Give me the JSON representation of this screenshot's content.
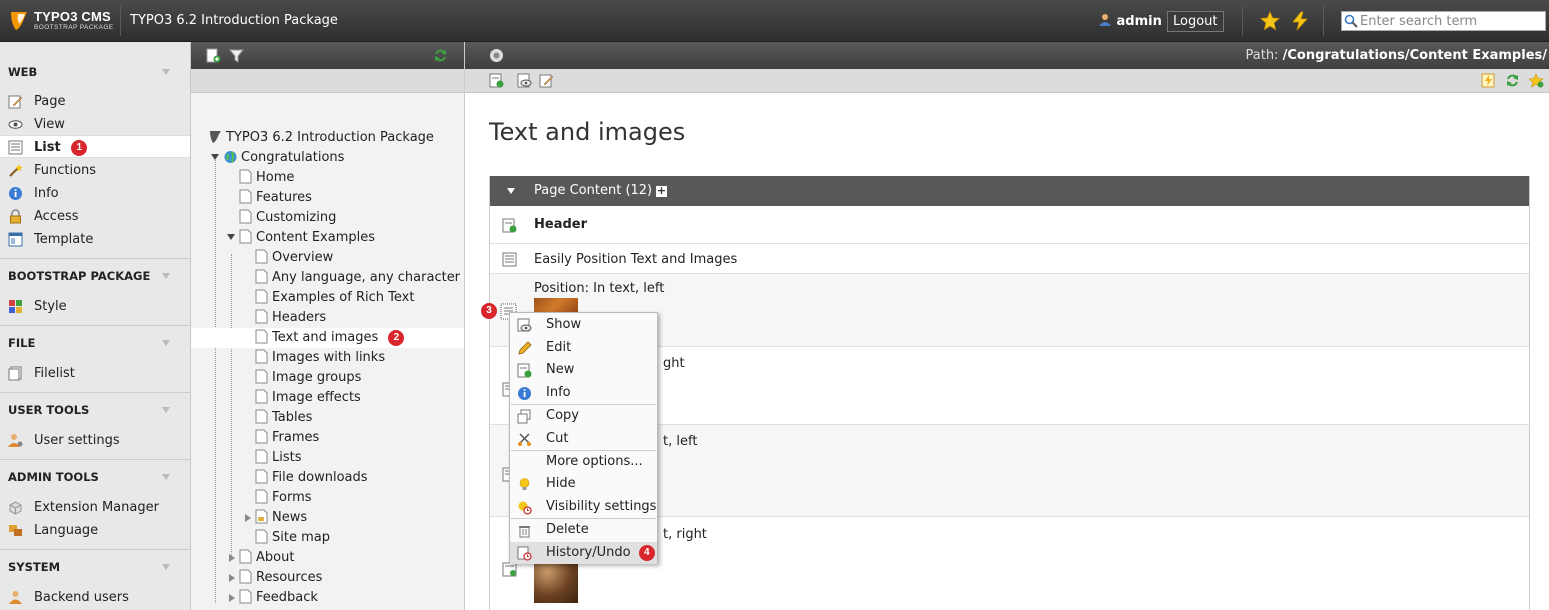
{
  "topbar": {
    "logo_name": "TYPO3 CMS",
    "logo_sub": "BOOTSTRAP PACKAGE",
    "site_title": "TYPO3 6.2 Introduction Package",
    "username": "admin",
    "logout_label": "Logout",
    "search_placeholder": "Enter search term"
  },
  "module_menu": {
    "groups": [
      {
        "label": "WEB",
        "items": [
          {
            "label": "Page",
            "icon": "page-edit-icon"
          },
          {
            "label": "View",
            "icon": "eye-icon"
          },
          {
            "label": "List",
            "icon": "list-icon",
            "active": true,
            "badge": "1"
          },
          {
            "label": "Functions",
            "icon": "wand-icon"
          },
          {
            "label": "Info",
            "icon": "info-icon"
          },
          {
            "label": "Access",
            "icon": "lock-icon"
          },
          {
            "label": "Template",
            "icon": "template-icon"
          }
        ]
      },
      {
        "label": "BOOTSTRAP PACKAGE",
        "items": [
          {
            "label": "Style",
            "icon": "style-icon"
          }
        ]
      },
      {
        "label": "FILE",
        "items": [
          {
            "label": "Filelist",
            "icon": "filelist-icon"
          }
        ]
      },
      {
        "label": "USER TOOLS",
        "items": [
          {
            "label": "User settings",
            "icon": "user-settings-icon"
          }
        ]
      },
      {
        "label": "ADMIN TOOLS",
        "items": [
          {
            "label": "Extension Manager",
            "icon": "extension-icon"
          },
          {
            "label": "Language",
            "icon": "language-icon"
          }
        ]
      },
      {
        "label": "SYSTEM",
        "items": [
          {
            "label": "Backend users",
            "icon": "backend-users-icon"
          }
        ]
      }
    ]
  },
  "page_tree": {
    "root": "TYPO3 6.2 Introduction Package",
    "site": "Congratulations",
    "level1": [
      "Home",
      "Features",
      "Customizing",
      "Content Examples"
    ],
    "content_examples": [
      "Overview",
      "Any language, any character",
      "Examples of Rich Text",
      "Headers",
      "Text and images",
      "Images with links",
      "Image groups",
      "Image effects",
      "Tables",
      "Frames",
      "Lists",
      "File downloads",
      "Forms",
      "News",
      "Site map"
    ],
    "level1_after": [
      "About",
      "Resources",
      "Feedback"
    ],
    "selected_badge": "2"
  },
  "content": {
    "path_label": "Path:",
    "path_value": "/Congratulations/Content Examples/",
    "page_title": "Text and images",
    "table_header": "Page Content (12)",
    "rows": {
      "header": "Header",
      "row2": "Easily Position Text and Images",
      "row3": "Position: In text, left",
      "row4": "ght",
      "row5": "t, left",
      "row6": "t, right"
    },
    "row_badge": "3"
  },
  "context_menu": {
    "items": [
      "Show",
      "Edit",
      "New",
      "Info",
      "Copy",
      "Cut",
      "More options...",
      "Hide",
      "Visibility settings",
      "Delete",
      "History/Undo"
    ],
    "history_badge": "4"
  },
  "colors": {
    "topbar": "#3a3a3a",
    "badge": "#d8262c",
    "table_head": "#585858"
  }
}
